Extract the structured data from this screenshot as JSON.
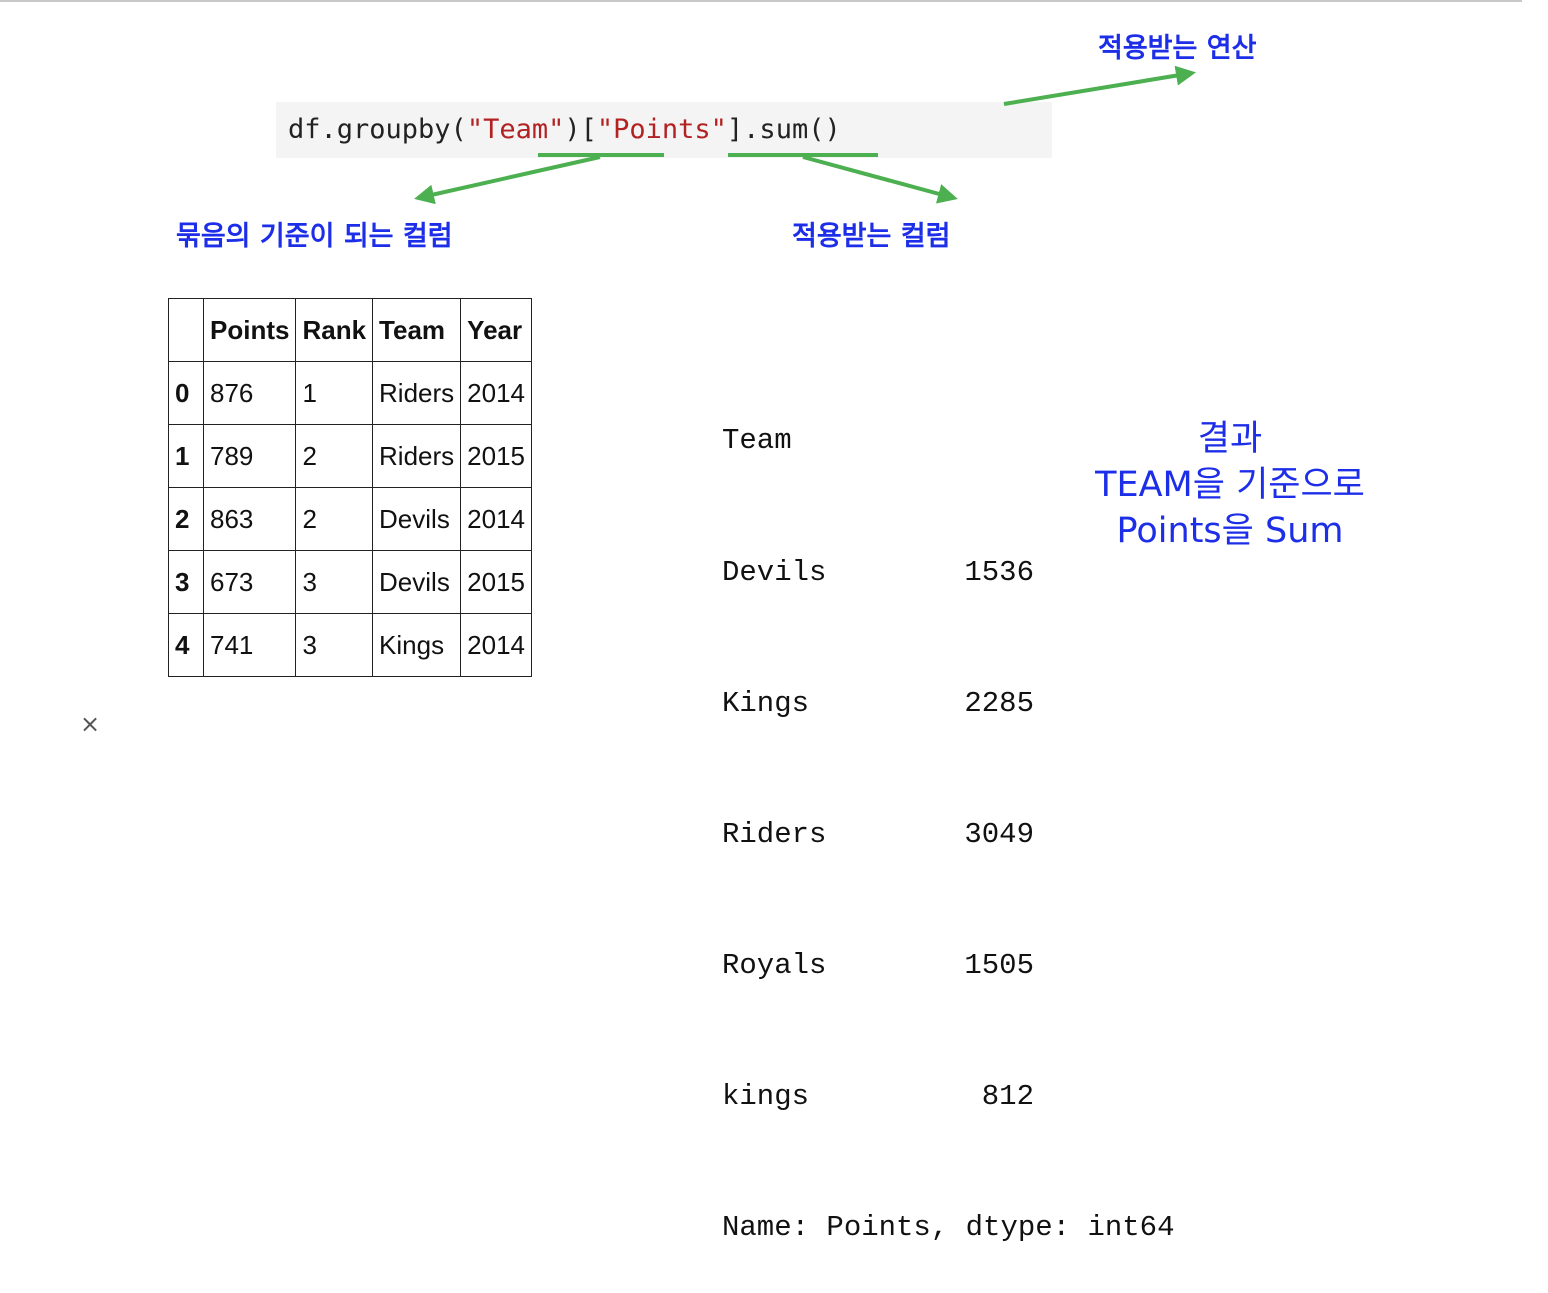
{
  "code": {
    "prefix": "df.groupby(",
    "group_key": "\"Team\"",
    "mid": ")[",
    "column": "\"Points\"",
    "suffix": "].sum()"
  },
  "annotations": {
    "operation": "적용받는 연산",
    "group_basis": "묶음의 기준이 되는 컬럼",
    "applied_column": "적용받는 컬럼"
  },
  "table": {
    "headers": [
      "",
      "Points",
      "Rank",
      "Team",
      "Year"
    ],
    "rows": [
      [
        "0",
        "876",
        "1",
        "Riders",
        "2014"
      ],
      [
        "1",
        "789",
        "2",
        "Riders",
        "2015"
      ],
      [
        "2",
        "863",
        "2",
        "Devils",
        "2014"
      ],
      [
        "3",
        "673",
        "3",
        "Devils",
        "2015"
      ],
      [
        "4",
        "741",
        "3",
        "Kings",
        "2014"
      ]
    ]
  },
  "output": {
    "header": "Team",
    "rows": [
      {
        "key": "Devils",
        "value": "1536"
      },
      {
        "key": "Kings",
        "value": "2285"
      },
      {
        "key": "Riders",
        "value": "3049"
      },
      {
        "key": "Royals",
        "value": "1505"
      },
      {
        "key": "kings",
        "value": "812"
      }
    ],
    "footer": "Name: Points, dtype: int64"
  },
  "result_note": {
    "line1": "결과",
    "line2": "TEAM을 기준으로",
    "line3": "Points을 Sum"
  },
  "close_icon": "×",
  "colors": {
    "annotation": "#1d2ee8",
    "arrow": "#4caf50",
    "string_literal": "#b22222",
    "code_bg": "#f4f4f4"
  }
}
